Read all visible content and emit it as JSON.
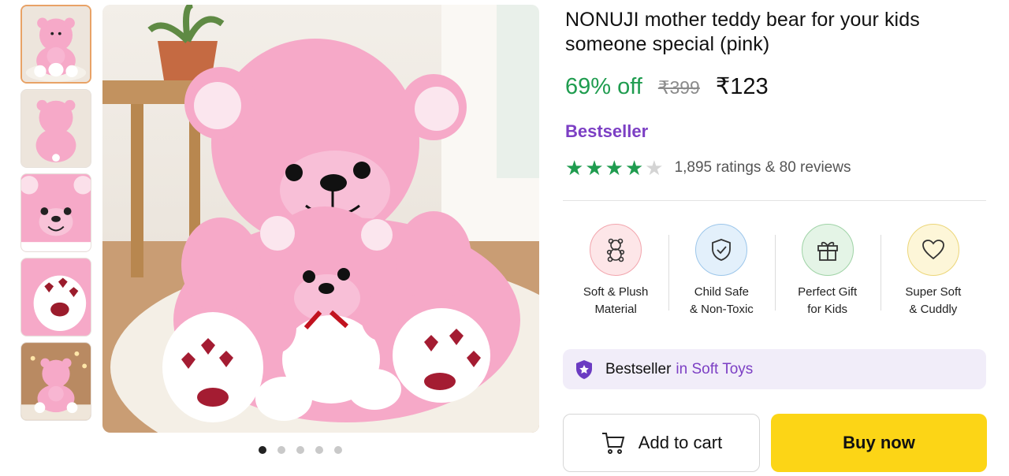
{
  "thumbnails": [
    {
      "label": "thumbnail-1",
      "active": true
    },
    {
      "label": "thumbnail-2",
      "active": false
    },
    {
      "label": "thumbnail-3",
      "active": false
    },
    {
      "label": "thumbnail-4",
      "active": false
    },
    {
      "label": "thumbnail-5",
      "active": false
    }
  ],
  "carousel": {
    "count": 5,
    "active_index": 0
  },
  "product": {
    "title": "NONUJI mother teddy bear for your kids someone special (pink)",
    "discount": "69% off",
    "mrp": "₹399",
    "price": "₹123",
    "tag": "Bestseller",
    "rating": 4,
    "rating_max": 5,
    "ratings_text": "1,895 ratings & 80 reviews"
  },
  "features": [
    {
      "icon": "teddy-bear-icon",
      "label": "Soft & Plush\nMaterial",
      "bg": "#fde6e8",
      "ring": "#f2a5ad"
    },
    {
      "icon": "shield-check-icon",
      "label": "Child Safe\n& Non-Toxic",
      "bg": "#e3f0fb",
      "ring": "#9cc6ea"
    },
    {
      "icon": "gift-icon",
      "label": "Perfect Gift\nfor Kids",
      "bg": "#e4f4e6",
      "ring": "#9fd3a6"
    },
    {
      "icon": "heart-icon",
      "label": "Super Soft\n& Cuddly",
      "bg": "#fdf6d8",
      "ring": "#ecd679"
    }
  ],
  "bestseller_banner": {
    "strong": "Bestseller",
    "category": "in Soft Toys",
    "icon": "star-shield-icon"
  },
  "buttons": {
    "add_to_cart": "Add to cart",
    "buy_now": "Buy now"
  },
  "colors": {
    "accent_green": "#1f9c4f",
    "accent_purple": "#7c3fc4",
    "buy_yellow": "#fcd516",
    "teddy_pink": "#f6a9c8"
  }
}
